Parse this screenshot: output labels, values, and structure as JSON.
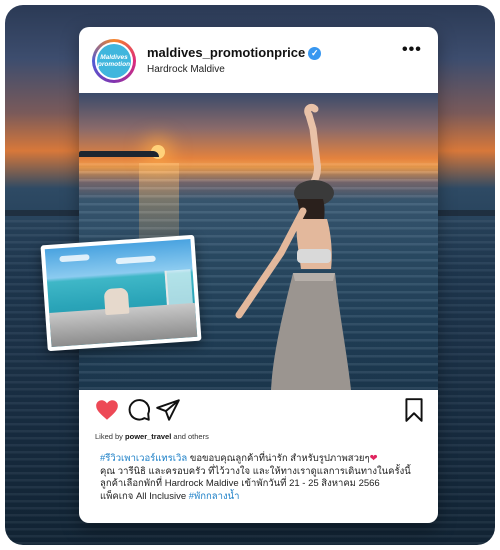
{
  "post": {
    "avatar_text": "Maldives promotion",
    "username": "maldives_promotionprice",
    "location": "Hardrock Maldive",
    "more": "•••",
    "liked_by_prefix": "Liked by ",
    "liked_by_user": "power_travel",
    "liked_by_suffix": " and others",
    "caption": {
      "tag1": "#รีวิวเพาเวอร์แทรเวิล",
      "line1": " ขอขอบคุณลูกค้าที่น่ารัก สำหรับรูปภาพสวยๆ",
      "line2": "คุณ วารีนิธิ และครอบครัว ที่ไว้วางใจ และให้ทางเราดูแลการเดินทางในครั้งนี้",
      "line3": "ลูกค้าเลือกพักที่ Hardrock Maldive เข้าพักวันที่ 21 - 25 สิงหาคม 2566",
      "line4": "แพ็คเกจ All Inclusive ",
      "tag2": "#พักกลางน้ำ"
    }
  },
  "icons": {
    "heart": "heart-icon",
    "comment": "comment-icon",
    "share": "send-icon",
    "save": "bookmark-icon",
    "verified": "verified-badge-icon",
    "more": "more-options-icon"
  },
  "colors": {
    "heart": "#ed4956",
    "verified": "#3897f0",
    "hashtag": "#1b7fc7"
  }
}
